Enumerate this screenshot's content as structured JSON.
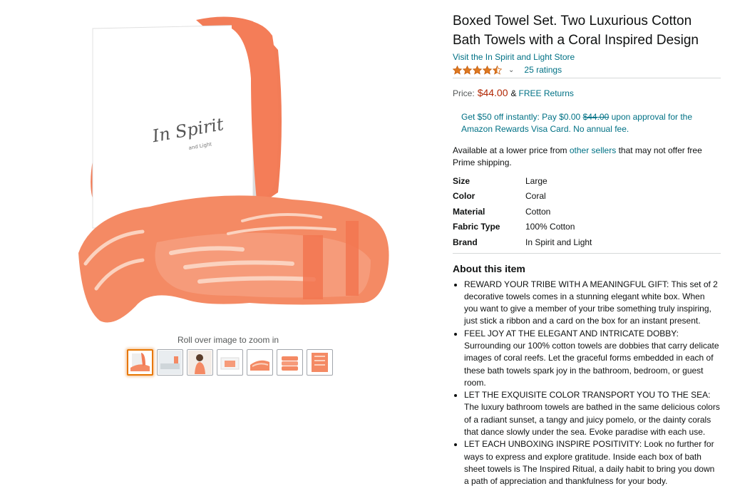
{
  "product": {
    "title": "Boxed Towel Set. Two Luxurious Cotton Bath Towels with a Coral Inspired Design",
    "store_link": "Visit the In Spirit and Light Store",
    "rating_value": 4.5,
    "rating_chevron": "⌄",
    "ratings_count": "25 ratings",
    "star_color": "#de7921"
  },
  "price": {
    "label": "Price:",
    "value": "$44.00",
    "amp": "&",
    "free_returns": "FREE Returns"
  },
  "promo": {
    "prefix": "Get $50 off instantly: Pay $0.00 ",
    "struck": "$44.00",
    "suffix": " upon approval for the Amazon Rewards Visa Card. No annual fee."
  },
  "lower_price": {
    "prefix": "Available at a lower price from ",
    "link": "other sellers",
    "suffix": " that may not offer free Prime shipping."
  },
  "specs": [
    {
      "key": "Size",
      "value": "Large"
    },
    {
      "key": "Color",
      "value": "Coral"
    },
    {
      "key": "Material",
      "value": "Cotton"
    },
    {
      "key": "Fabric Type",
      "value": "100% Cotton"
    },
    {
      "key": "Brand",
      "value": "In Spirit and Light"
    }
  ],
  "about": {
    "title": "About this item",
    "bullets": [
      "REWARD YOUR TRIBE WITH A MEANINGFUL GIFT: This set of 2 decorative towels comes in a stunning elegant white box. When you want to give a member of your tribe something truly inspiring, just stick a ribbon and a card on the box for an instant present.",
      "FEEL JOY AT THE ELEGANT AND INTRICATE DOBBY: Surrounding our 100% cotton towels are dobbies that carry delicate images of coral reefs. Let the graceful forms embedded in each of these bath towels spark joy in the bathroom, bedroom, or guest room.",
      "LET THE EXQUISITE COLOR TRANSPORT YOU TO THE SEA: The luxury bathroom towels are bathed in the same delicious colors of a radiant sunset, a tangy and juicy pomelo, or the dainty corals that dance slowly under the sea. Evoke paradise with each use.",
      "LET EACH UNBOXING INSPIRE POSITIVITY: Look no further for ways to express and explore gratitude. Inside each box of bath sheet towels is The Inspired Ritual, a daily habit to bring you down a path of appreciation and thankfulness for your body."
    ]
  },
  "gallery": {
    "zoom_hint": "Roll over image to zoom in",
    "box_logo": "In Spirit",
    "box_logo_sub": "and Light",
    "towel_color": "#f4845f",
    "thumbnails": [
      {
        "name": "thumb-towel-box",
        "selected": true
      },
      {
        "name": "thumb-bath-scene"
      },
      {
        "name": "thumb-model"
      },
      {
        "name": "thumb-box-open"
      },
      {
        "name": "thumb-towel-folded"
      },
      {
        "name": "thumb-towel-stack"
      },
      {
        "name": "thumb-towel-flat"
      }
    ]
  }
}
